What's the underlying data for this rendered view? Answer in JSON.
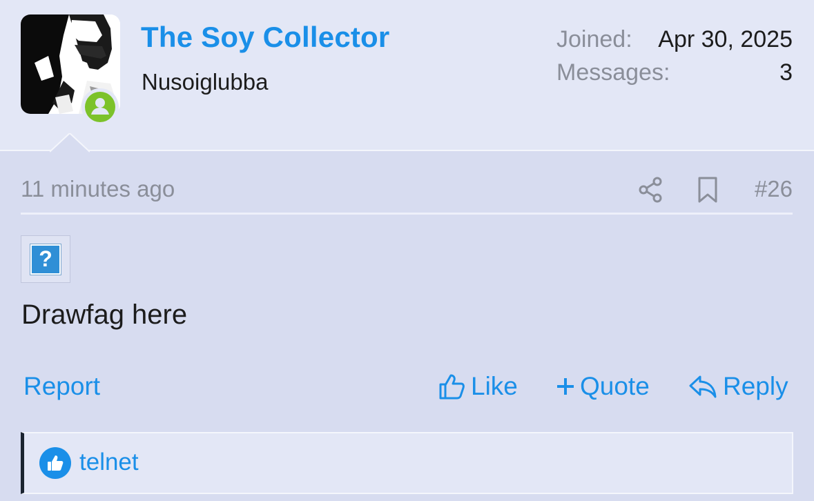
{
  "user": {
    "name": "The Soy Collector",
    "title": "Nusoiglubba",
    "joined_label": "Joined:",
    "joined_value": "Apr 30, 2025",
    "messages_label": "Messages:",
    "messages_value": "3",
    "status": "online"
  },
  "post": {
    "time": "11 minutes ago",
    "number": "#26",
    "text": "Drawfag here",
    "broken_image_glyph": "?"
  },
  "actions": {
    "report": "Report",
    "like": "Like",
    "quote": "Quote",
    "reply": "Reply"
  },
  "reactions": {
    "user": "telnet",
    "type": "like"
  },
  "colors": {
    "accent": "#1a8fe8",
    "online": "#7cc22a",
    "background": "#d7dcf0",
    "header_background": "#e3e7f6"
  }
}
